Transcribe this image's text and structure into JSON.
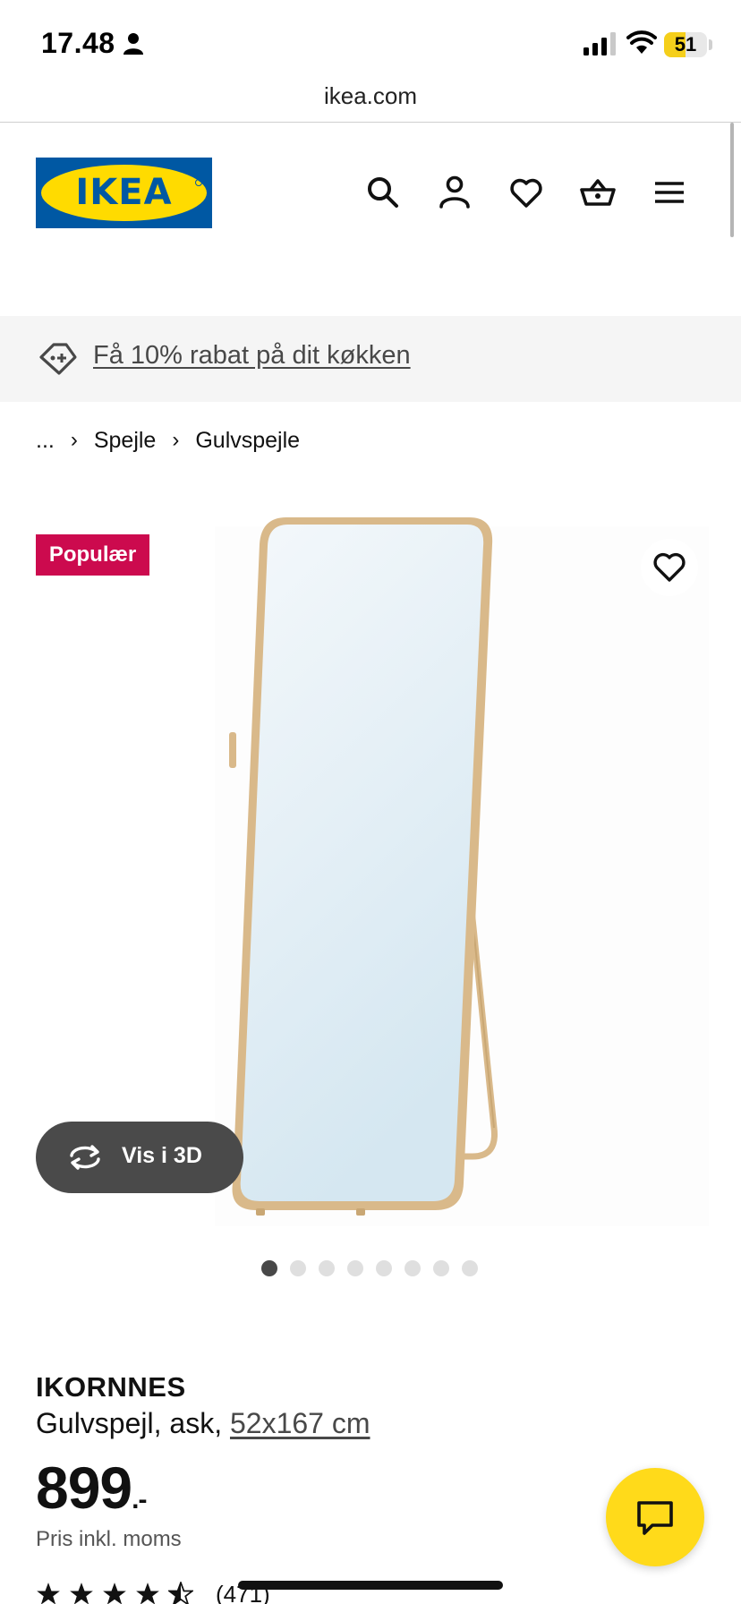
{
  "status_bar": {
    "time": "17.48",
    "battery_level": "51"
  },
  "browser": {
    "url": "ikea.com"
  },
  "header": {
    "logo_text": "IKEA",
    "icons": [
      "search-icon",
      "account-icon",
      "heart-icon",
      "basket-icon",
      "menu-icon"
    ]
  },
  "promo": {
    "text": "Få 10% rabat på dit køkken"
  },
  "breadcrumb": {
    "items": [
      "...",
      "Spejle",
      "Gulvspejle"
    ]
  },
  "product": {
    "badge": "Populær",
    "view_3d_label": "Vis i 3D",
    "image_count": 8,
    "active_image": 1,
    "name": "IKORNNES",
    "description": "Gulvspejl, ask, ",
    "size": "52x167 cm",
    "price": "899",
    "price_suffix": ".-",
    "price_note": "Pris inkl. moms",
    "rating_stars": 4.5,
    "rating_count": "(471)"
  },
  "colors": {
    "ikea_blue": "#0058a3",
    "ikea_yellow": "#ffdb00",
    "badge_red": "#cc0a4e",
    "chat_yellow": "#ffda1a",
    "wood": "#d9b98a"
  }
}
